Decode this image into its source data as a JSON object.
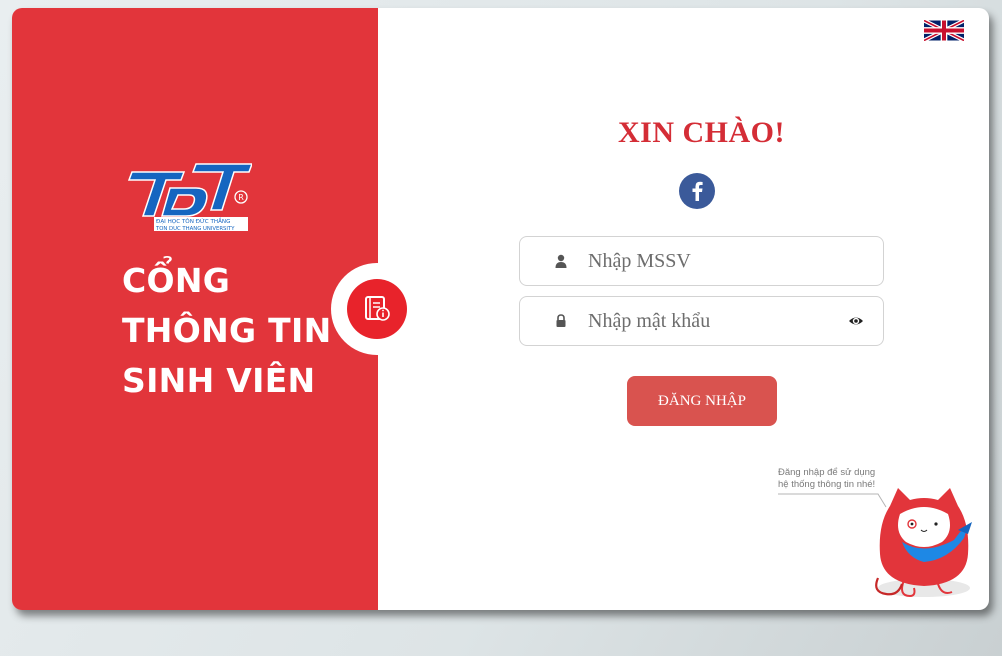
{
  "brand": {
    "logo_text": "TĐT",
    "logo_sub1": "ĐẠI HỌC TÔN ĐỨC THẮNG",
    "logo_sub2": "TON DUC THANG UNIVERSITY",
    "title_lines": [
      "CỔNG",
      "THÔNG TIN",
      "SINH VIÊN"
    ],
    "primary_color": "#e2353b"
  },
  "header": {
    "language_flag": "uk-flag-icon"
  },
  "login": {
    "greeting": "XIN CHÀO!",
    "facebook_icon": "facebook-icon",
    "student_id": {
      "placeholder": "Nhập MSSV",
      "value": "",
      "icon": "user-icon"
    },
    "password": {
      "placeholder": "Nhập mật khẩu",
      "value": "",
      "icon": "lock-icon",
      "toggle_icon": "eye-icon"
    },
    "submit_label": "ĐĂNG NHẬP",
    "button_color": "#d9534f"
  },
  "mascot": {
    "note_line1": "Đăng nhập để sử dụng",
    "note_line2": "hệ thống thông tin nhé!"
  }
}
